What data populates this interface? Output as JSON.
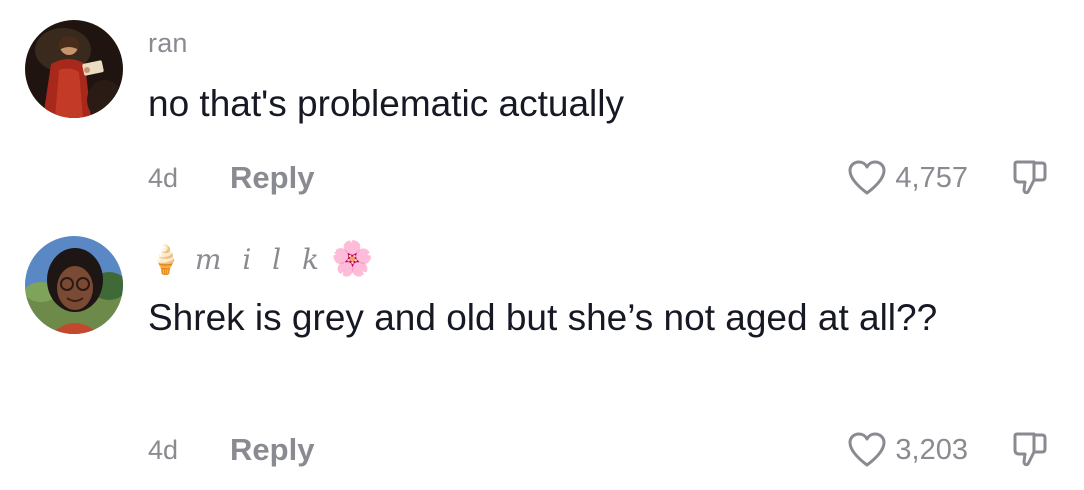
{
  "comments": [
    {
      "avatar_icon": "renaissance-painting-avatar",
      "username": "ran",
      "text": "no that's problematic actually",
      "time": "4d",
      "reply_label": "Reply",
      "like_count": "4,757"
    },
    {
      "avatar_icon": "selfie-avatar",
      "username_prefix_emoji": "🍦",
      "username": "m i l k",
      "username_suffix_emoji": "🌸",
      "text": "Shrek is grey and old but she’s not aged at all??",
      "time": "4d",
      "reply_label": "Reply",
      "like_count": "3,203"
    }
  ],
  "icons": {
    "like": "heart-outline-icon",
    "dislike": "thumbs-down-outline-icon"
  },
  "colors": {
    "text_primary": "#161823",
    "text_secondary": "#8a8b91",
    "background": "#ffffff"
  }
}
